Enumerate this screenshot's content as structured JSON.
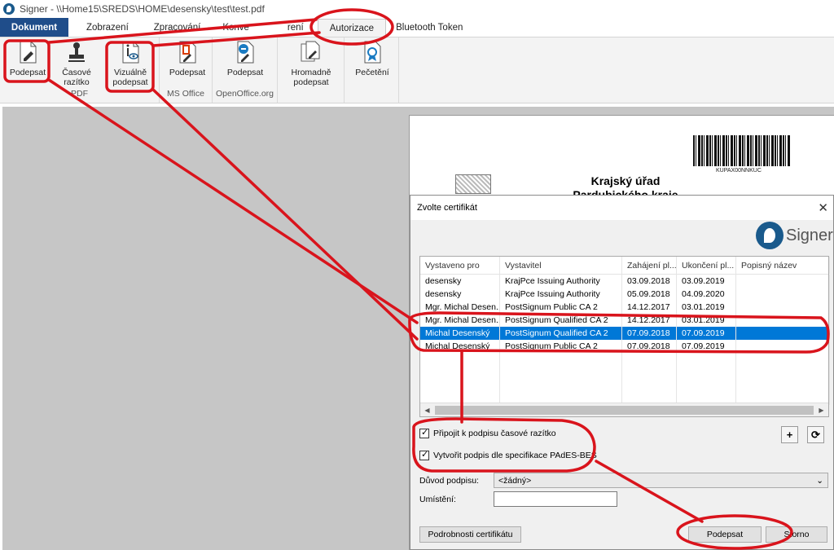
{
  "window": {
    "title": "Signer - \\\\Home15\\SREDS\\HOME\\desensky\\test\\test.pdf"
  },
  "ribbon_tabs": [
    {
      "label": "Dokument"
    },
    {
      "label": "Zobrazení"
    },
    {
      "label": "Zpracování"
    },
    {
      "label": "Konve"
    },
    {
      "label": "rení"
    },
    {
      "label": "Autorizace"
    },
    {
      "label": "Bluetooth Token"
    }
  ],
  "ribbon": {
    "pdf_group": {
      "label": "PDF",
      "buttons": [
        {
          "label": "Podepsat",
          "icon": "pen-document-icon"
        },
        {
          "label": "Časové razítko",
          "icon": "stamp-icon"
        },
        {
          "label": "Vizuálně podepsat",
          "icon": "visual-sign-icon"
        }
      ]
    },
    "msoffice_group": {
      "label": "MS Office",
      "button": "Podepsat"
    },
    "openoffice_group": {
      "label": "OpenOffice.org",
      "button": "Podepsat"
    },
    "bulk_group": {
      "button": "Hromadně podepsat"
    },
    "seal_group": {
      "button": "Pečetění"
    }
  },
  "pdf_page": {
    "barcode_text": "KUPAX00NNKUC",
    "heading_line1": "Krajský úřad",
    "heading_line2": "Pardubického kraje"
  },
  "dialog": {
    "title": "Zvolte certifikát",
    "close_glyph": "✕",
    "logo_text": "Signer",
    "columns": [
      "Vystaveno pro",
      "Vystavitel",
      "Zahájení pl...",
      "Ukončení pl...",
      "Popisný název"
    ],
    "rows": [
      [
        "desensky",
        "KrajPce Issuing Authority",
        "03.09.2018",
        "03.09.2019",
        ""
      ],
      [
        "desensky",
        "KrajPce Issuing Authority",
        "05.09.2018",
        "04.09.2020",
        ""
      ],
      [
        "Mgr. Michal Desen...",
        "PostSignum Public CA 2",
        "14.12.2017",
        "03.01.2019",
        ""
      ],
      [
        "Mgr. Michal Desen...",
        "PostSignum Qualified CA 2",
        "14.12.2017",
        "03.01.2019",
        ""
      ],
      [
        "Michal Desenský",
        "PostSignum Qualified CA 2",
        "07.09.2018",
        "07.09.2019",
        ""
      ],
      [
        "Michal Desenský",
        "PostSignum Public CA 2",
        "07.09.2018",
        "07.09.2019",
        ""
      ]
    ],
    "selected_row": 4,
    "timestamp_checkbox": {
      "label": "Připojit k podpisu časové razítko",
      "checked": true
    },
    "pades_checkbox": {
      "label": "Vytvořit podpis dle specifikace PAdES-BES",
      "checked": true
    },
    "add_button": "+",
    "refresh_button": "⟳",
    "reason_label": "Důvod podpisu:",
    "reason_value": "<žádný>",
    "location_label": "Umístění:",
    "location_value": "",
    "details_button": "Podrobnosti certifikátu",
    "sign_button": "Podepsat",
    "cancel_button": "Storno"
  },
  "colors": {
    "annotation": "#d9141c",
    "selection": "#0078d7",
    "file_tab": "#1f4d8a"
  }
}
